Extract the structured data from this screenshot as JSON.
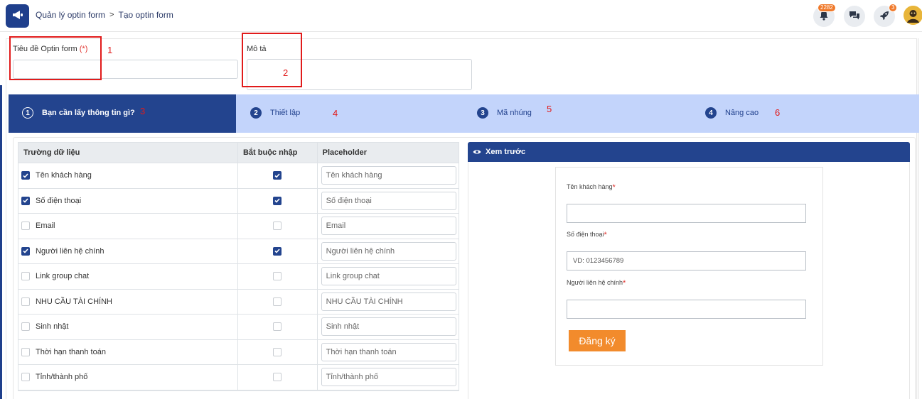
{
  "breadcrumb": {
    "parent": "Quản lý optin form",
    "separator": ">",
    "current": "Tạo optin form"
  },
  "top_icons": {
    "notifications_badge": "2282",
    "rocket_badge": "3",
    "icons": [
      "megaphone-icon",
      "bell-icon",
      "chat-icon",
      "rocket-icon",
      "avatar"
    ]
  },
  "form": {
    "title_label": "Tiêu đề Optin form",
    "title_required": "(*)",
    "title_value": "",
    "description_label": "Mô tả",
    "description_value": ""
  },
  "annotations": [
    "1",
    "2",
    "3",
    "4",
    "5",
    "6"
  ],
  "steps": [
    {
      "num": "1",
      "label": "Bạn cần lấy thông tin gì?",
      "active": true
    },
    {
      "num": "2",
      "label": "Thiết lập",
      "active": false
    },
    {
      "num": "3",
      "label": "Mã nhúng",
      "active": false
    },
    {
      "num": "4",
      "label": "Nâng cao",
      "active": false
    }
  ],
  "table": {
    "headers": [
      "Trường dữ liệu",
      "Bắt buộc nhập",
      "Placeholder"
    ],
    "rows": [
      {
        "field": "Tên khách hàng",
        "selected": true,
        "required": true,
        "placeholder": "Tên khách hàng"
      },
      {
        "field": "Số điện thoại",
        "selected": true,
        "required": true,
        "placeholder": "Số điện thoại"
      },
      {
        "field": "Email",
        "selected": false,
        "required": false,
        "placeholder": "Email"
      },
      {
        "field": "Người liên hệ chính",
        "selected": true,
        "required": true,
        "placeholder": "Người liên hệ chính"
      },
      {
        "field": "Link group chat",
        "selected": false,
        "required": false,
        "placeholder": "Link group chat"
      },
      {
        "field": "NHU CẦU TÀI CHÍNH",
        "selected": false,
        "required": false,
        "placeholder": "NHU CẦU TÀI CHÍNH"
      },
      {
        "field": "Sinh nhật",
        "selected": false,
        "required": false,
        "placeholder": "Sinh nhật"
      },
      {
        "field": "Thời hạn thanh toán",
        "selected": false,
        "required": false,
        "placeholder": "Thời hạn thanh toán"
      },
      {
        "field": "Tỉnh/thành phố",
        "selected": false,
        "required": false,
        "placeholder": "Tỉnh/thành phố"
      }
    ]
  },
  "preview": {
    "title": "Xem trước",
    "fields": [
      {
        "label": "Tên khách hàng",
        "star": "*",
        "value": ""
      },
      {
        "label": "Số điện thoại",
        "star": "*",
        "value": "VD: 0123456789"
      },
      {
        "label": "Người liên hệ chính",
        "star": "*",
        "value": ""
      }
    ],
    "submit_label": "Đăng ký"
  },
  "colors": {
    "primary": "#23448e",
    "step_bar": "#c3d4fb",
    "accent_orange": "#f28b2c",
    "annotation_red": "#e11b1b"
  }
}
